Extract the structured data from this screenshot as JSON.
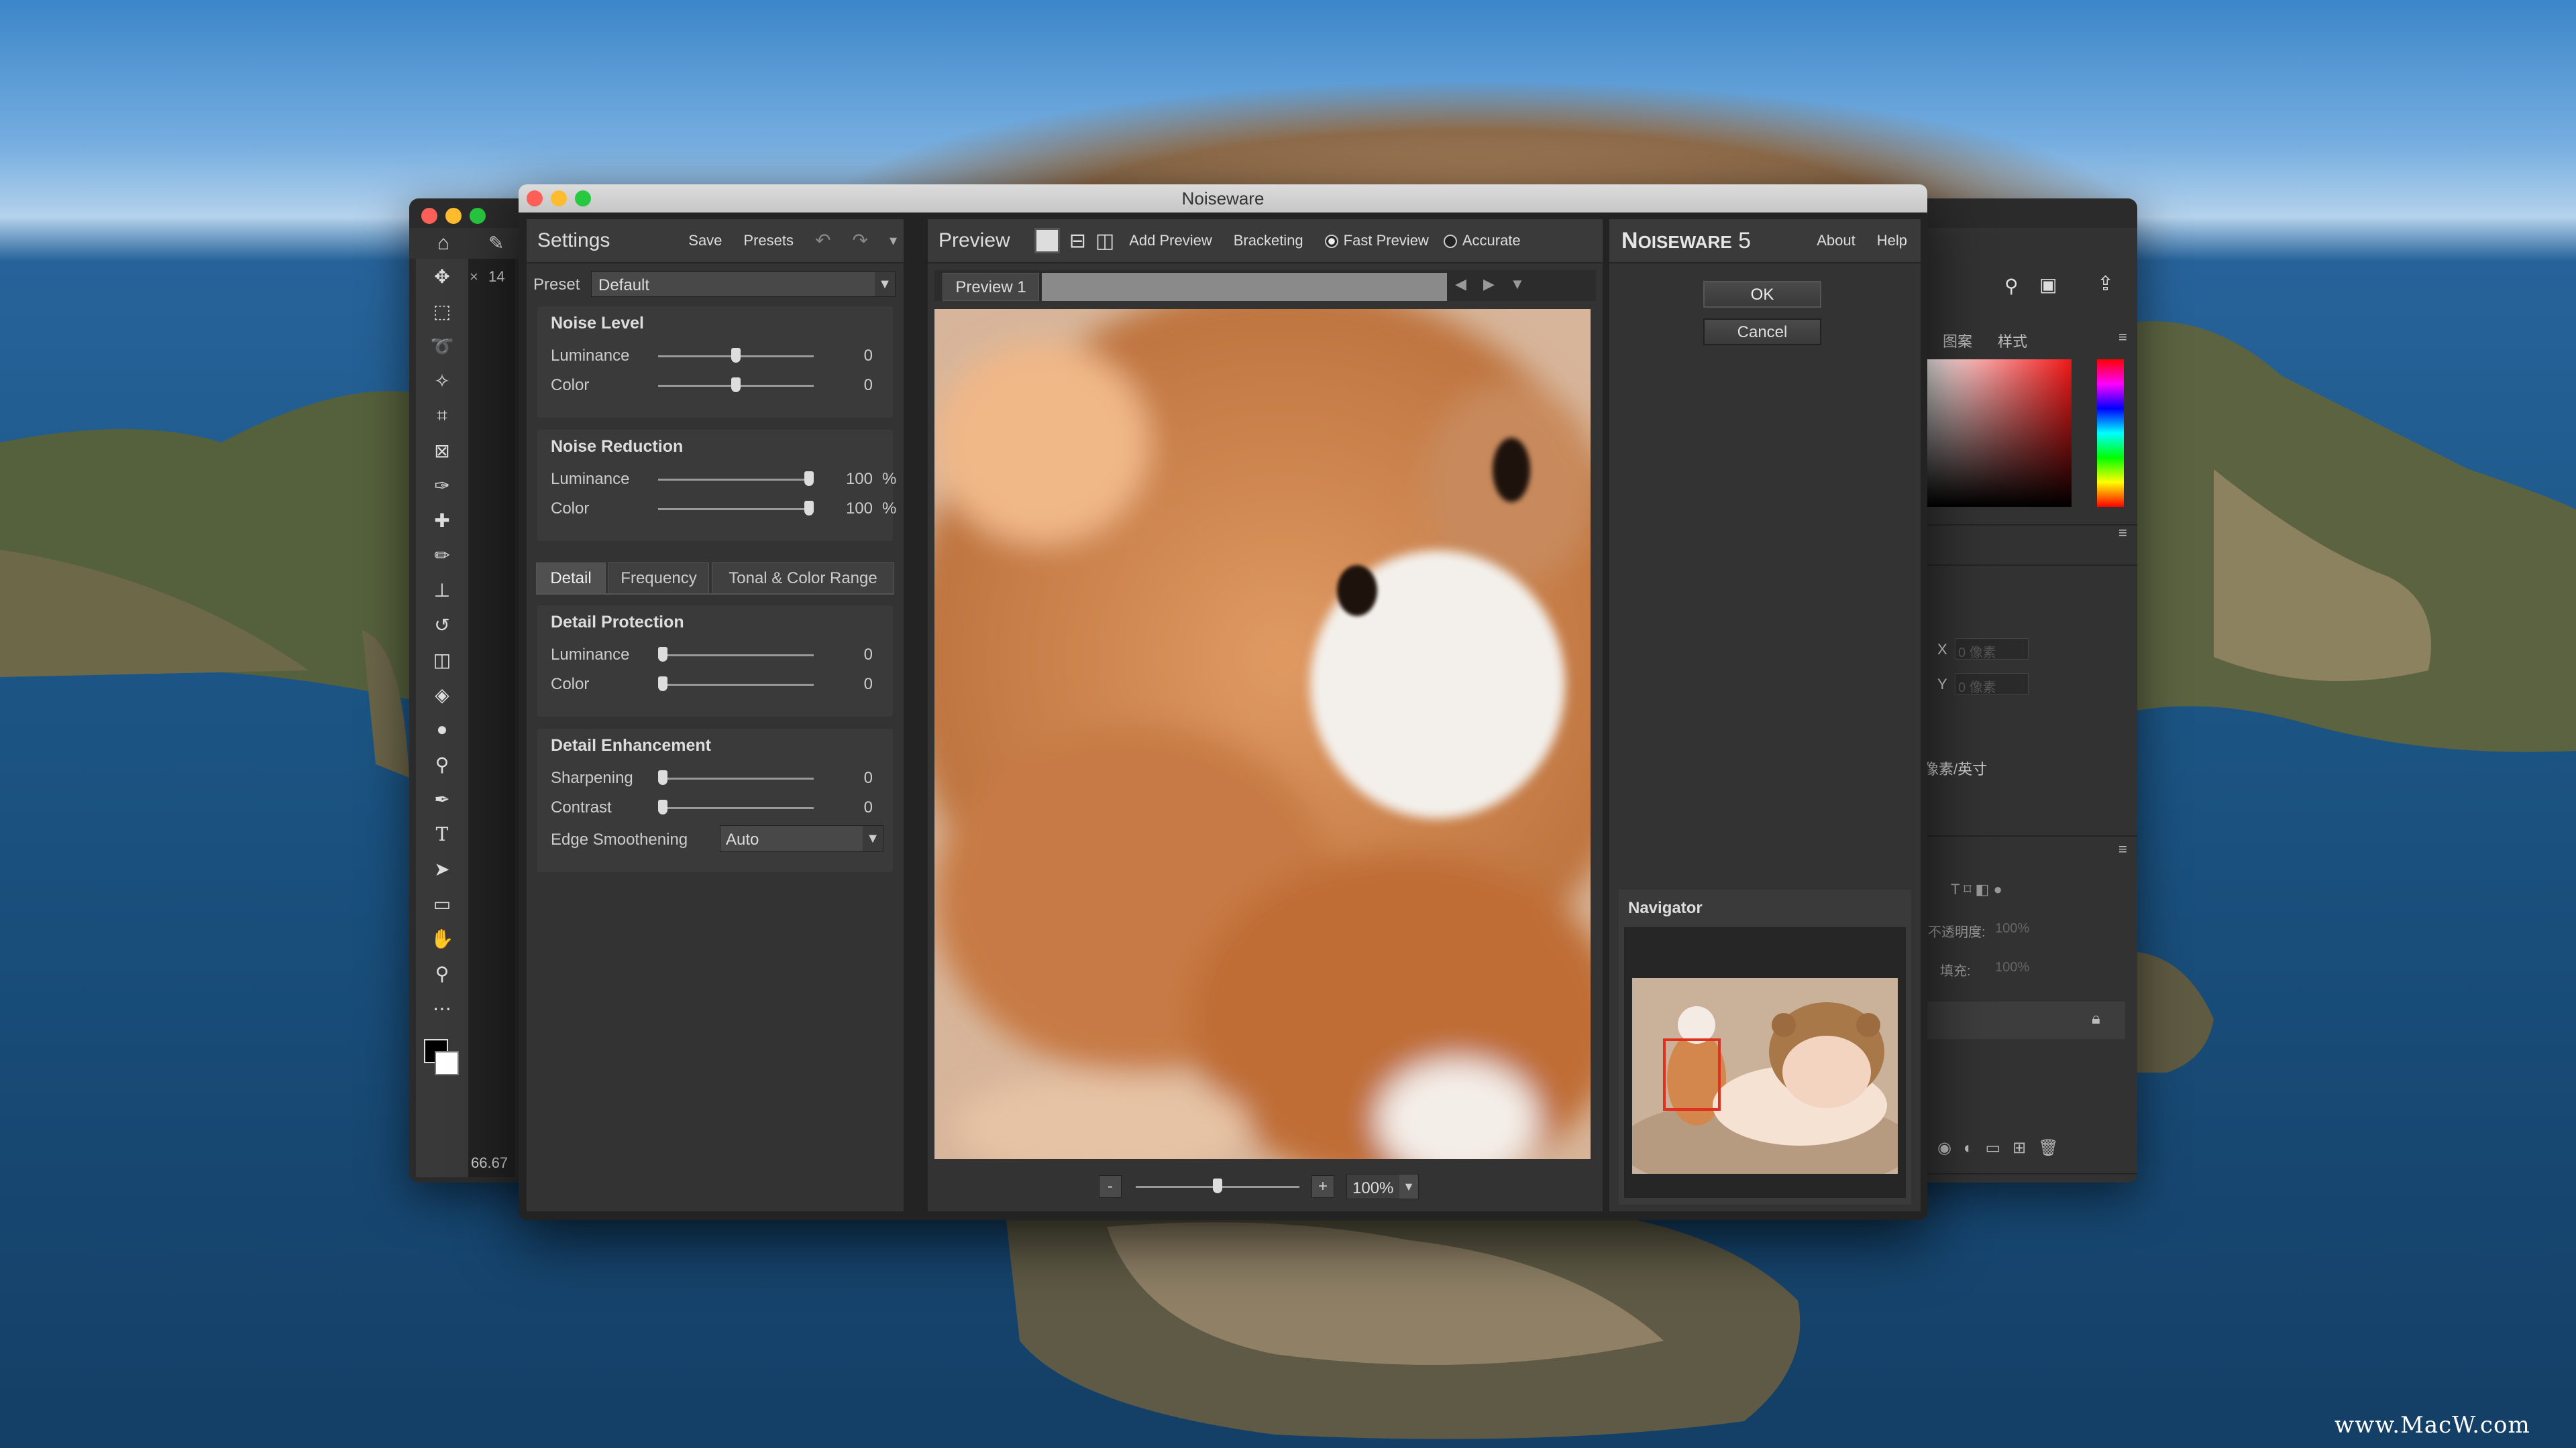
{
  "colors": {
    "accent_ok": "#3d3d3d",
    "preview_bg": "#c78a5a",
    "nav_marker": "#e03020"
  },
  "ps": {
    "tab_close": "×",
    "tab_label": "14",
    "zoom_value": "66.67",
    "right_tabs": [
      "图案",
      "样式"
    ],
    "x_label": "X",
    "x_value": "0 像素",
    "y_label": "Y",
    "y_value": "0 像素",
    "res_unit": "像素/英寸",
    "opacity_label": "不透明度:",
    "opacity_value": "100%",
    "fill_label": "填充:",
    "fill_value": "100%"
  },
  "dialog": {
    "title": "Noiseware"
  },
  "settings": {
    "title": "Settings",
    "save": "Save",
    "presets": "Presets",
    "preset_label": "Preset",
    "preset_value": "Default",
    "noise_level": {
      "title": "Noise Level",
      "rows": [
        {
          "label": "Luminance",
          "value": "0",
          "unit": ""
        },
        {
          "label": "Color",
          "value": "0",
          "unit": ""
        }
      ]
    },
    "noise_reduction": {
      "title": "Noise Reduction",
      "rows": [
        {
          "label": "Luminance",
          "value": "100",
          "unit": "%"
        },
        {
          "label": "Color",
          "value": "100",
          "unit": "%"
        }
      ]
    },
    "tabs": [
      "Detail",
      "Frequency",
      "Tonal & Color Range"
    ],
    "detail_protection": {
      "title": "Detail Protection",
      "rows": [
        {
          "label": "Luminance",
          "value": "0",
          "unit": ""
        },
        {
          "label": "Color",
          "value": "0",
          "unit": ""
        }
      ]
    },
    "detail_enhancement": {
      "title": "Detail Enhancement",
      "rows": [
        {
          "label": "Sharpening",
          "value": "0",
          "unit": ""
        },
        {
          "label": "Contrast",
          "value": "0",
          "unit": ""
        }
      ]
    },
    "edge_smoothing": {
      "label": "Edge Smoothening",
      "value": "Auto"
    }
  },
  "slider_levels": {
    "noise_level_luminance": 0.5,
    "noise_level_color": 0.5,
    "noise_reduction_luminance": 1.0,
    "noise_reduction_color": 1.0,
    "detail_protection_luminance": 0.0,
    "detail_protection_color": 0.0,
    "sharpening": 0.0,
    "contrast": 0.0,
    "preview_zoom": 0.5
  },
  "preview": {
    "title": "Preview",
    "add_preview": "Add Preview",
    "bracketing": "Bracketing",
    "fast_preview": "Fast Preview",
    "accurate": "Accurate",
    "tab": "Preview 1",
    "zoom_minus": "-",
    "zoom_plus": "+",
    "zoom": "100%"
  },
  "right": {
    "brand_big": "N",
    "brand_rest": "OISEWARE",
    "version": "5",
    "about": "About",
    "help": "Help",
    "ok": "OK",
    "cancel": "Cancel",
    "navigator": "Navigator"
  },
  "watermark": "www.MacW.com"
}
